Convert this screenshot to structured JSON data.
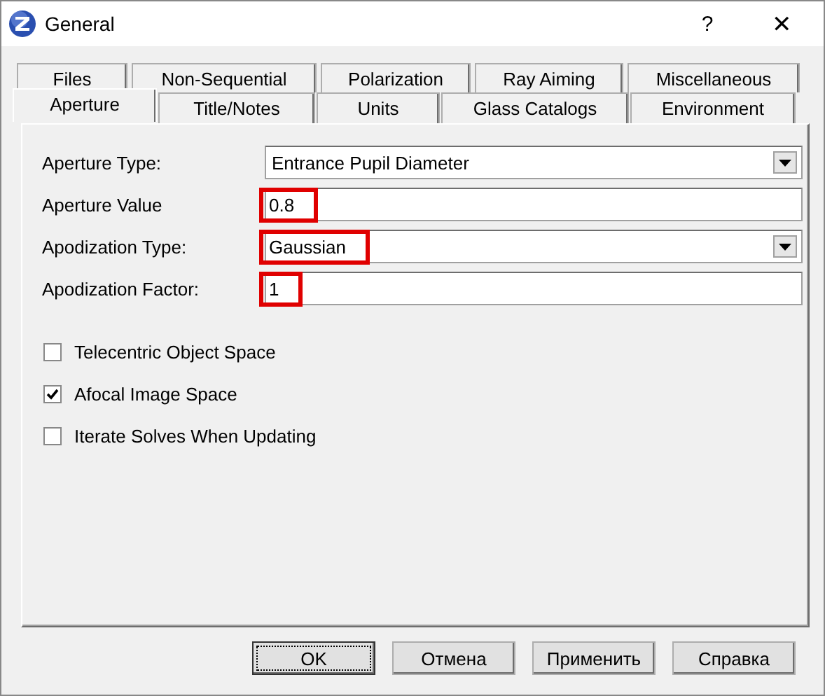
{
  "window": {
    "title": "General",
    "help": "?",
    "close": "✕"
  },
  "tab_rows": [
    [
      {
        "label": "Files",
        "selected": false
      },
      {
        "label": "Non-Sequential",
        "selected": false
      },
      {
        "label": "Polarization",
        "selected": false
      },
      {
        "label": "Ray Aiming",
        "selected": false
      },
      {
        "label": "Miscellaneous",
        "selected": false
      }
    ],
    [
      {
        "label": "Aperture",
        "selected": true
      },
      {
        "label": "Title/Notes",
        "selected": false
      },
      {
        "label": "Units",
        "selected": false
      },
      {
        "label": "Glass Catalogs",
        "selected": false
      },
      {
        "label": "Environment",
        "selected": false
      }
    ]
  ],
  "fields": [
    {
      "label": "Aperture Type:",
      "kind": "dropdown",
      "value": "Entrance Pupil Diameter",
      "highlighted": false
    },
    {
      "label": "Aperture Value",
      "kind": "text",
      "value": "0.8",
      "highlighted": true
    },
    {
      "label": "Apodization Type:",
      "kind": "dropdown",
      "value": "Gaussian",
      "highlighted": true
    },
    {
      "label": "Apodization Factor:",
      "kind": "text",
      "value": "1",
      "highlighted": true
    }
  ],
  "checkboxes": [
    {
      "label": "Telecentric Object Space",
      "checked": false
    },
    {
      "label": "Afocal Image Space",
      "checked": true
    },
    {
      "label": "Iterate Solves When Updating",
      "checked": false
    }
  ],
  "buttons": [
    {
      "label": "OK",
      "default": true
    },
    {
      "label": "Отмена",
      "default": false
    },
    {
      "label": "Применить",
      "default": false
    },
    {
      "label": "Справка",
      "default": false
    }
  ]
}
